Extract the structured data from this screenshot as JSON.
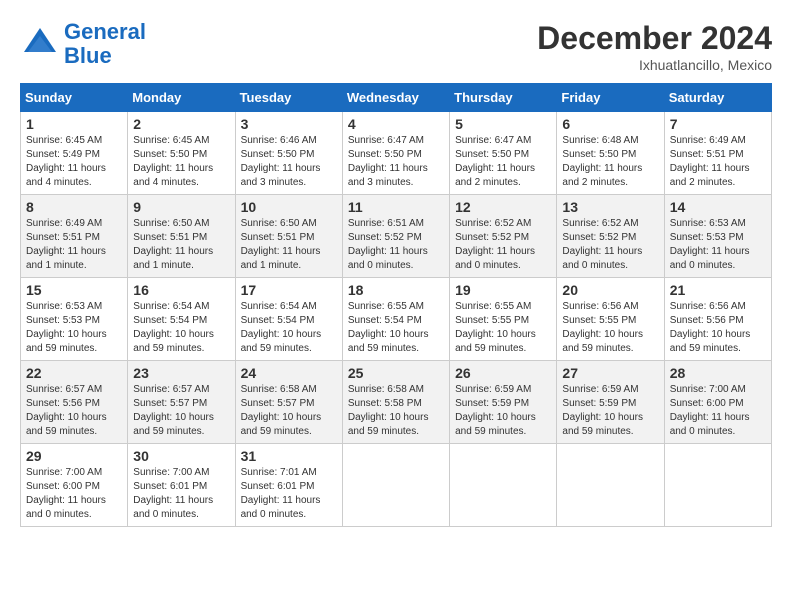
{
  "header": {
    "logo_line1": "General",
    "logo_line2": "Blue",
    "month": "December 2024",
    "location": "Ixhuatlancillo, Mexico"
  },
  "weekdays": [
    "Sunday",
    "Monday",
    "Tuesday",
    "Wednesday",
    "Thursday",
    "Friday",
    "Saturday"
  ],
  "weeks": [
    [
      {
        "day": "1",
        "sunrise": "6:45 AM",
        "sunset": "5:49 PM",
        "daylight": "11 hours and 4 minutes."
      },
      {
        "day": "2",
        "sunrise": "6:45 AM",
        "sunset": "5:50 PM",
        "daylight": "11 hours and 4 minutes."
      },
      {
        "day": "3",
        "sunrise": "6:46 AM",
        "sunset": "5:50 PM",
        "daylight": "11 hours and 3 minutes."
      },
      {
        "day": "4",
        "sunrise": "6:47 AM",
        "sunset": "5:50 PM",
        "daylight": "11 hours and 3 minutes."
      },
      {
        "day": "5",
        "sunrise": "6:47 AM",
        "sunset": "5:50 PM",
        "daylight": "11 hours and 2 minutes."
      },
      {
        "day": "6",
        "sunrise": "6:48 AM",
        "sunset": "5:50 PM",
        "daylight": "11 hours and 2 minutes."
      },
      {
        "day": "7",
        "sunrise": "6:49 AM",
        "sunset": "5:51 PM",
        "daylight": "11 hours and 2 minutes."
      }
    ],
    [
      {
        "day": "8",
        "sunrise": "6:49 AM",
        "sunset": "5:51 PM",
        "daylight": "11 hours and 1 minute."
      },
      {
        "day": "9",
        "sunrise": "6:50 AM",
        "sunset": "5:51 PM",
        "daylight": "11 hours and 1 minute."
      },
      {
        "day": "10",
        "sunrise": "6:50 AM",
        "sunset": "5:51 PM",
        "daylight": "11 hours and 1 minute."
      },
      {
        "day": "11",
        "sunrise": "6:51 AM",
        "sunset": "5:52 PM",
        "daylight": "11 hours and 0 minutes."
      },
      {
        "day": "12",
        "sunrise": "6:52 AM",
        "sunset": "5:52 PM",
        "daylight": "11 hours and 0 minutes."
      },
      {
        "day": "13",
        "sunrise": "6:52 AM",
        "sunset": "5:52 PM",
        "daylight": "11 hours and 0 minutes."
      },
      {
        "day": "14",
        "sunrise": "6:53 AM",
        "sunset": "5:53 PM",
        "daylight": "11 hours and 0 minutes."
      }
    ],
    [
      {
        "day": "15",
        "sunrise": "6:53 AM",
        "sunset": "5:53 PM",
        "daylight": "10 hours and 59 minutes."
      },
      {
        "day": "16",
        "sunrise": "6:54 AM",
        "sunset": "5:54 PM",
        "daylight": "10 hours and 59 minutes."
      },
      {
        "day": "17",
        "sunrise": "6:54 AM",
        "sunset": "5:54 PM",
        "daylight": "10 hours and 59 minutes."
      },
      {
        "day": "18",
        "sunrise": "6:55 AM",
        "sunset": "5:54 PM",
        "daylight": "10 hours and 59 minutes."
      },
      {
        "day": "19",
        "sunrise": "6:55 AM",
        "sunset": "5:55 PM",
        "daylight": "10 hours and 59 minutes."
      },
      {
        "day": "20",
        "sunrise": "6:56 AM",
        "sunset": "5:55 PM",
        "daylight": "10 hours and 59 minutes."
      },
      {
        "day": "21",
        "sunrise": "6:56 AM",
        "sunset": "5:56 PM",
        "daylight": "10 hours and 59 minutes."
      }
    ],
    [
      {
        "day": "22",
        "sunrise": "6:57 AM",
        "sunset": "5:56 PM",
        "daylight": "10 hours and 59 minutes."
      },
      {
        "day": "23",
        "sunrise": "6:57 AM",
        "sunset": "5:57 PM",
        "daylight": "10 hours and 59 minutes."
      },
      {
        "day": "24",
        "sunrise": "6:58 AM",
        "sunset": "5:57 PM",
        "daylight": "10 hours and 59 minutes."
      },
      {
        "day": "25",
        "sunrise": "6:58 AM",
        "sunset": "5:58 PM",
        "daylight": "10 hours and 59 minutes."
      },
      {
        "day": "26",
        "sunrise": "6:59 AM",
        "sunset": "5:59 PM",
        "daylight": "10 hours and 59 minutes."
      },
      {
        "day": "27",
        "sunrise": "6:59 AM",
        "sunset": "5:59 PM",
        "daylight": "10 hours and 59 minutes."
      },
      {
        "day": "28",
        "sunrise": "7:00 AM",
        "sunset": "6:00 PM",
        "daylight": "11 hours and 0 minutes."
      }
    ],
    [
      {
        "day": "29",
        "sunrise": "7:00 AM",
        "sunset": "6:00 PM",
        "daylight": "11 hours and 0 minutes."
      },
      {
        "day": "30",
        "sunrise": "7:00 AM",
        "sunset": "6:01 PM",
        "daylight": "11 hours and 0 minutes."
      },
      {
        "day": "31",
        "sunrise": "7:01 AM",
        "sunset": "6:01 PM",
        "daylight": "11 hours and 0 minutes."
      },
      null,
      null,
      null,
      null
    ]
  ]
}
